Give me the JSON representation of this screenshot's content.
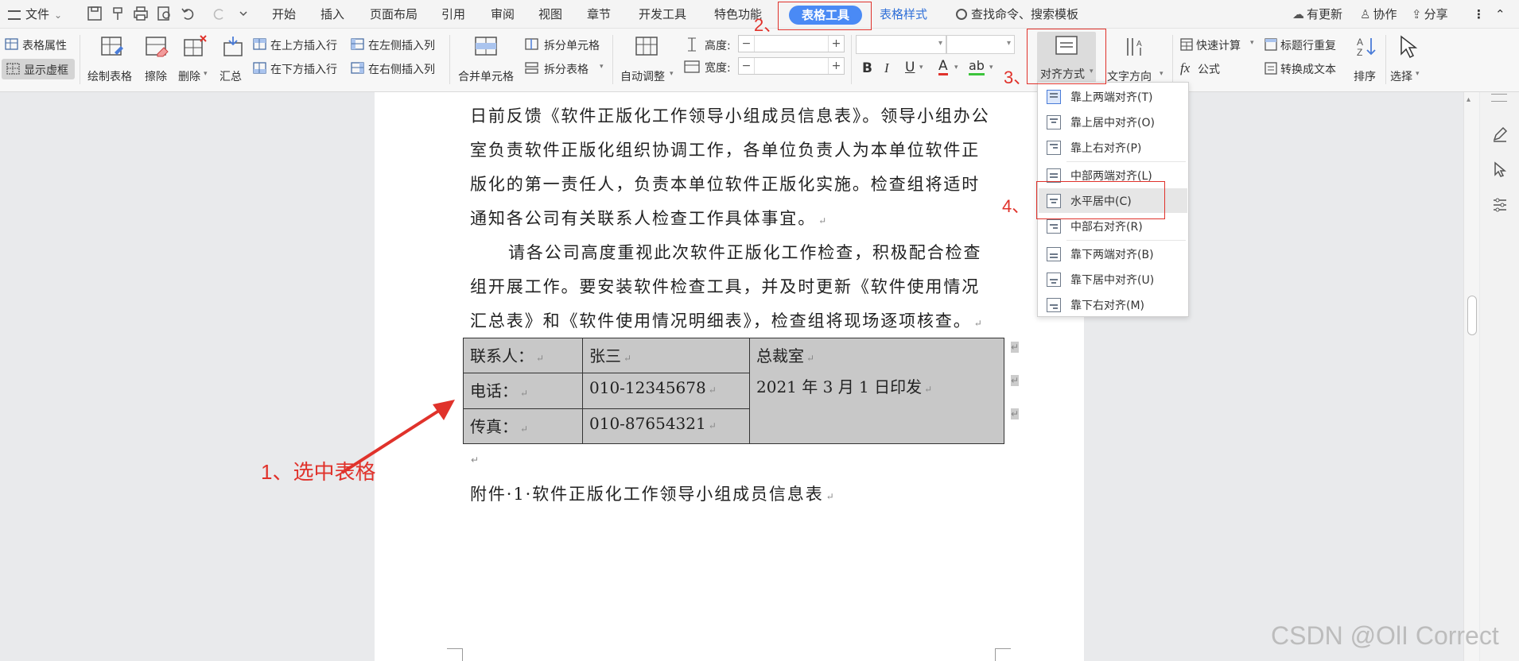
{
  "menubar": {
    "file_label": "文件",
    "tabs": [
      "开始",
      "插入",
      "页面布局",
      "引用",
      "审阅",
      "视图",
      "章节",
      "开发工具",
      "特色功能"
    ],
    "active_tab": "表格工具",
    "tab_table_style": "表格样式",
    "search_placeholder": "查找命令、搜索模板",
    "right": {
      "update": "有更新",
      "collab": "协作",
      "share": "分享"
    }
  },
  "ribbon": {
    "table_props": "表格属性",
    "show_gridlines": "显示虚框",
    "draw_table": "绘制表格",
    "erase": "擦除",
    "delete": "删除",
    "summary": "汇总",
    "insert_above": "在上方插入行",
    "insert_below": "在下方插入行",
    "insert_left": "在左侧插入列",
    "insert_right": "在右侧插入列",
    "merge_cells": "合并单元格",
    "split_cells": "拆分单元格",
    "split_table": "拆分表格",
    "autofit": "自动调整",
    "height_label": "高度:",
    "width_label": "宽度:",
    "bold": "B",
    "italic": "I",
    "underline": "U",
    "font_color": "A",
    "highlight": "ab",
    "align": "对齐方式",
    "text_direction": "文字方向",
    "quick_calc": "快速计算",
    "formula": "公式",
    "repeat_header": "标题行重复",
    "to_text": "转换成文本",
    "sort": "排序",
    "select": "选择"
  },
  "document": {
    "paragraphs": [
      "日前反馈《软件正版化工作领导小组成员信息表》。领导小组办公",
      "室负责软件正版化组织协调工作，各单位负责人为本单位软件正",
      "版化的第一责任人，负责本单位软件正版化实施。检查组将适时",
      "通知各公司有关联系人检查工作具体事宜。",
      "请各公司高度重视此次软件正版化工作检查，积极配合检查",
      "组开展工作。要安装软件检查工具，并及时更新《软件使用情况",
      "汇总表》和《软件使用情况明细表》，检查组将现场逐项核查。"
    ],
    "table": {
      "rows": [
        [
          "联系人：",
          "张三"
        ],
        [
          "电话：",
          "010-12345678"
        ],
        [
          "传真：",
          "010-87654321"
        ]
      ],
      "merged_line1": "总裁室",
      "merged_line2": "2021 年 3 月 1 日印发"
    },
    "attachment": "附件·1·软件正版化工作领导小组成员信息表"
  },
  "align_menu": {
    "items": [
      "靠上两端对齐(T)",
      "靠上居中对齐(O)",
      "靠上右对齐(P)",
      "中部两端对齐(L)",
      "水平居中(C)",
      "中部右对齐(R)",
      "靠下两端对齐(B)",
      "靠下居中对齐(U)",
      "靠下右对齐(M)"
    ],
    "highlighted_index": 4
  },
  "annotations": {
    "step1": "1、选中表格",
    "step2": "2、",
    "step3": "3、",
    "step4": "4、"
  },
  "watermark": "CSDN @OlI Correct",
  "colors": {
    "accent": "#4a8af5",
    "annotation_red": "#e0322b",
    "table_fill": "#c8c8c8"
  }
}
